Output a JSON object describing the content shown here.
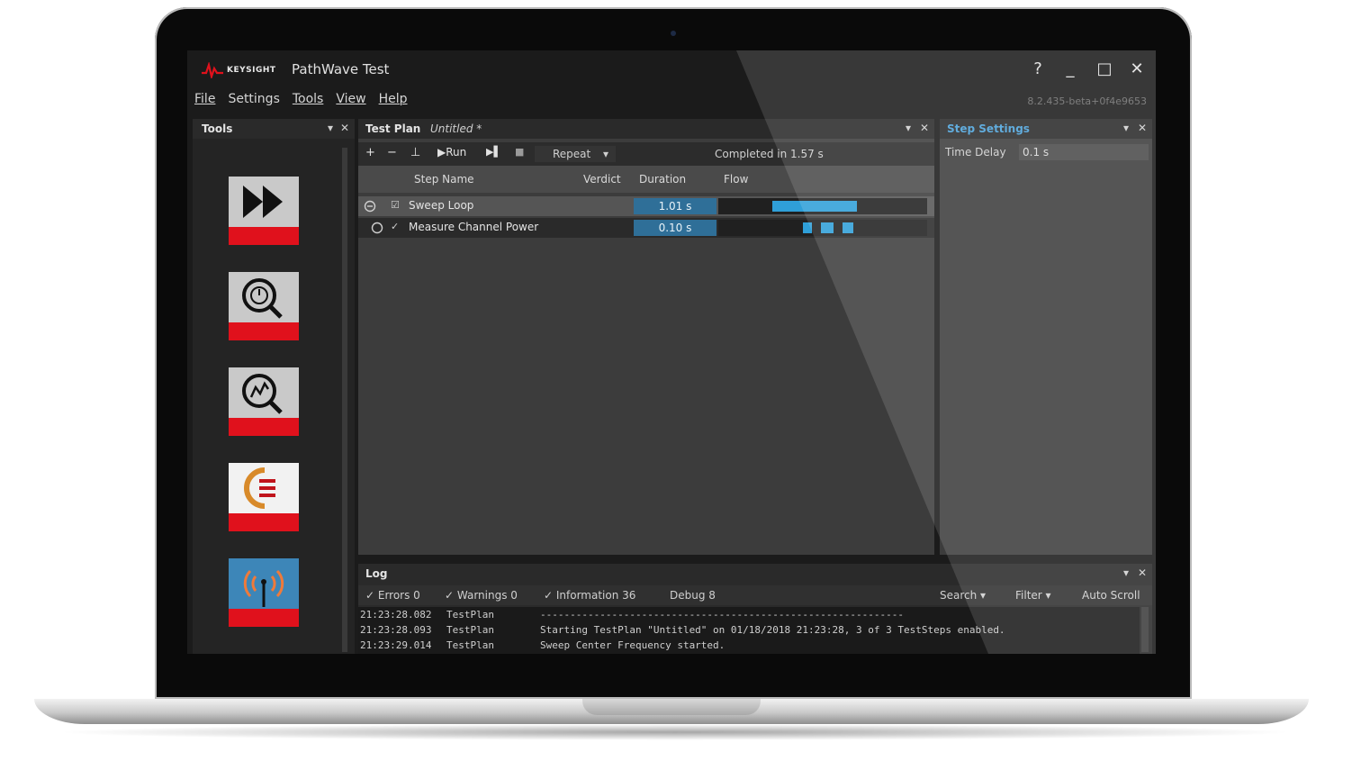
{
  "app": {
    "brand": "KEYSIGHT",
    "title": "PathWave Test",
    "version": "8.2.435-beta+0f4e9653",
    "window_controls": {
      "help": "?",
      "minimize": "_",
      "maximize": "□",
      "close": "✕"
    }
  },
  "menu": [
    {
      "label": "File"
    },
    {
      "label": "Settings"
    },
    {
      "label": "Tools"
    },
    {
      "label": "View"
    },
    {
      "label": "Help"
    }
  ],
  "tools_panel": {
    "title": "Tools",
    "pin": "▾",
    "close": "✕",
    "tiles": [
      {
        "icon": "fast-forward-icon"
      },
      {
        "icon": "timer-search-icon"
      },
      {
        "icon": "chart-search-icon"
      },
      {
        "icon": "keysight-logo-icon"
      },
      {
        "icon": "signal-tower-icon"
      }
    ]
  },
  "test_plan": {
    "title": "Test Plan",
    "subtitle": "Untitled *",
    "pin": "▾",
    "close": "✕",
    "toolbar": {
      "add": "+",
      "remove": "−",
      "insert": "⊥",
      "run": "▶Run",
      "step": "▶▌",
      "stop": "■",
      "repeat": "Repeat",
      "repeat_arrow": "▾",
      "completed": "Completed in 1.57 s"
    },
    "columns": {
      "step_name": "Step Name",
      "verdict": "Verdict",
      "duration": "Duration",
      "flow": "Flow"
    },
    "rows": [
      {
        "name": "Sweep Loop",
        "check": "☑",
        "duration": "1.01 s"
      },
      {
        "name": "Measure Channel Power",
        "check": "✓",
        "duration": "0.10 s"
      }
    ]
  },
  "step_settings": {
    "title": "Step Settings",
    "pin": "▾",
    "close": "✕",
    "field_label": "Time Delay",
    "field_value": "0.1 s"
  },
  "log": {
    "title": "Log",
    "pin": "▾",
    "close": "✕",
    "filters": {
      "errors": "✓ Errors 0",
      "warnings": "✓ Warnings 0",
      "information": "✓ Information 36",
      "debug": "Debug 8",
      "search": "Search ▾",
      "filter": "Filter ▾",
      "auto_scroll": "Auto Scroll"
    },
    "lines": [
      {
        "time": "21:23:28.082",
        "source": "TestPlan",
        "message": "-------------------------------------------------------------"
      },
      {
        "time": "21:23:28.093",
        "source": "TestPlan",
        "message": "Starting TestPlan \"Untitled\" on 01/18/2018 21:23:28, 3 of 3 TestSteps enabled."
      },
      {
        "time": "21:23:29.014",
        "source": "TestPlan",
        "message": "Sweep Center Frequency started."
      }
    ]
  },
  "colors": {
    "accent_blue": "#2f9fd8",
    "duration_blue": "#2f6f98",
    "tile_red": "#e0111c",
    "tile_gray": "#c9c9c9",
    "step_settings_title": "#4aa0d8"
  }
}
